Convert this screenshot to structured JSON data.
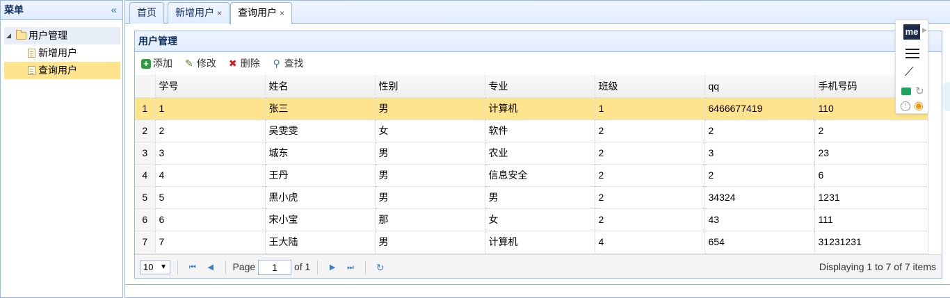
{
  "west": {
    "title": "菜单",
    "collapse_icon": "double-chevron-left-icon",
    "tree": {
      "root": "用户管理",
      "children": [
        "新增用户",
        "查询用户"
      ],
      "selected": "查询用户"
    }
  },
  "tabs": [
    {
      "label": "首页",
      "closable": false
    },
    {
      "label": "新增用户",
      "closable": true
    },
    {
      "label": "查询用户",
      "closable": true,
      "active": true
    }
  ],
  "panel": {
    "title": "用户管理",
    "toolbar": [
      {
        "label": "添加",
        "icon": "add-icon"
      },
      {
        "label": "修改",
        "icon": "pencil-icon"
      },
      {
        "label": "删除",
        "icon": "delete-icon"
      },
      {
        "label": "查找",
        "icon": "search-icon"
      }
    ]
  },
  "grid": {
    "columns": [
      "学号",
      "姓名",
      "性别",
      "专业",
      "班级",
      "qq",
      "手机号码"
    ],
    "rows": [
      {
        "n": "1",
        "cells": [
          "1",
          "张三",
          "男",
          "计算机",
          "1",
          "6466677419",
          "110"
        ],
        "selected": true
      },
      {
        "n": "2",
        "cells": [
          "2",
          "吴雯雯",
          "女",
          "软件",
          "2",
          "2",
          "2"
        ]
      },
      {
        "n": "3",
        "cells": [
          "3",
          "城东",
          "男",
          "农业",
          "2",
          "3",
          "23"
        ]
      },
      {
        "n": "4",
        "cells": [
          "4",
          "王丹",
          "男",
          "信息安全",
          "2",
          "2",
          "6"
        ]
      },
      {
        "n": "5",
        "cells": [
          "5",
          "黑小虎",
          "男",
          "男",
          "2",
          "34324",
          "1231"
        ]
      },
      {
        "n": "6",
        "cells": [
          "6",
          "宋小宝",
          "那",
          "女",
          "2",
          "43",
          "111"
        ]
      },
      {
        "n": "7",
        "cells": [
          "7",
          "王大陆",
          "男",
          "计算机",
          "4",
          "654",
          "31231231"
        ]
      }
    ]
  },
  "pager": {
    "page_size": "10",
    "page_label": "Page",
    "page_value": "1",
    "of_label": "of 1",
    "info": "Displaying 1 to 7 of 7 items"
  },
  "widget": {
    "logo": "me"
  },
  "colors": {
    "border": "#95b8e7",
    "selected_row": "#ffe48d",
    "header_bg": "#e0ecff"
  }
}
